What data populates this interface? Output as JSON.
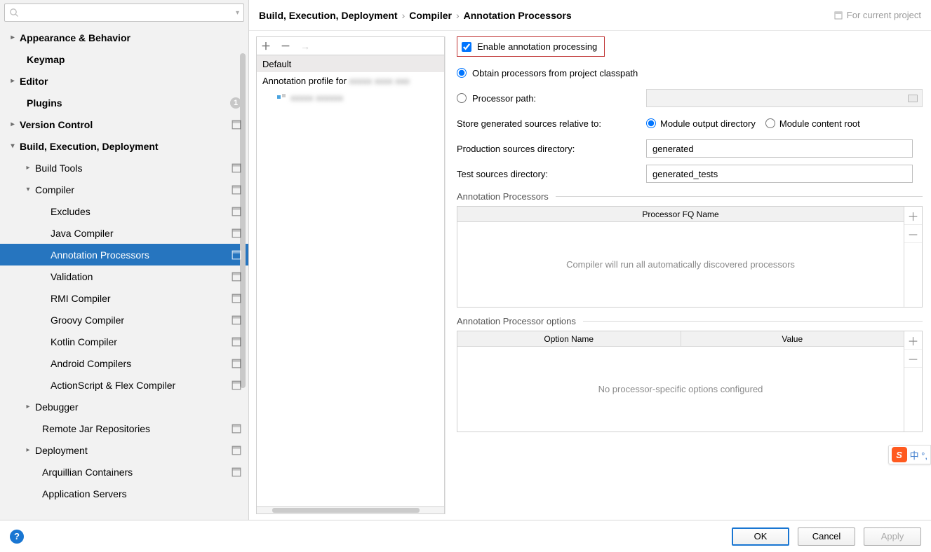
{
  "search": {
    "placeholder": ""
  },
  "sidebar": {
    "items": [
      {
        "label": "Appearance & Behavior",
        "bold": true,
        "chev": "right",
        "pad": "pad0"
      },
      {
        "label": "Keymap",
        "bold": true,
        "pad": "pad0c"
      },
      {
        "label": "Editor",
        "bold": true,
        "chev": "right",
        "pad": "pad0"
      },
      {
        "label": "Plugins",
        "bold": true,
        "pad": "pad0c",
        "badge": "1"
      },
      {
        "label": "Version Control",
        "bold": true,
        "chev": "right",
        "pad": "pad0",
        "proj": true
      },
      {
        "label": "Build, Execution, Deployment",
        "bold": true,
        "chev": "down",
        "pad": "pad0"
      },
      {
        "label": "Build Tools",
        "chev": "right",
        "pad": "pad1",
        "proj": true
      },
      {
        "label": "Compiler",
        "chev": "down",
        "pad": "pad1",
        "proj": true
      },
      {
        "label": "Excludes",
        "pad": "pad2",
        "proj": true
      },
      {
        "label": "Java Compiler",
        "pad": "pad2",
        "proj": true
      },
      {
        "label": "Annotation Processors",
        "pad": "pad2",
        "proj": true,
        "selected": true
      },
      {
        "label": "Validation",
        "pad": "pad2",
        "proj": true
      },
      {
        "label": "RMI Compiler",
        "pad": "pad2",
        "proj": true
      },
      {
        "label": "Groovy Compiler",
        "pad": "pad2",
        "proj": true
      },
      {
        "label": "Kotlin Compiler",
        "pad": "pad2",
        "proj": true
      },
      {
        "label": "Android Compilers",
        "pad": "pad2",
        "proj": true
      },
      {
        "label": "ActionScript & Flex Compiler",
        "pad": "pad2",
        "proj": true
      },
      {
        "label": "Debugger",
        "chev": "right",
        "pad": "pad1"
      },
      {
        "label": "Remote Jar Repositories",
        "pad": "pad1c",
        "proj": true
      },
      {
        "label": "Deployment",
        "chev": "right",
        "pad": "pad1",
        "proj": true
      },
      {
        "label": "Arquillian Containers",
        "pad": "pad1c",
        "proj": true
      },
      {
        "label": "Application Servers",
        "pad": "pad1c"
      }
    ]
  },
  "breadcrumb": {
    "a": "Build, Execution, Deployment",
    "b": "Compiler",
    "c": "Annotation Processors"
  },
  "forProject": "For current project",
  "profileList": {
    "default": "Default",
    "profile": "Annotation profile for",
    "profileBlur": "xxxxx xxxx xxo",
    "childBlur": "xxxxx xxxxxx"
  },
  "settings": {
    "enable": "Enable annotation processing",
    "obtain": "Obtain processors from project classpath",
    "procPath": "Processor path:",
    "storeLabel": "Store generated sources relative to:",
    "storeOpt1": "Module output directory",
    "storeOpt2": "Module content root",
    "prodLabel": "Production sources directory:",
    "prodVal": "generated",
    "testLabel": "Test sources directory:",
    "testVal": "generated_tests",
    "tbl1Title": "Annotation Processors",
    "tbl1Col": "Processor FQ Name",
    "tbl1Empty": "Compiler will run all automatically discovered processors",
    "tbl2Title": "Annotation Processor options",
    "tbl2Col1": "Option Name",
    "tbl2Col2": "Value",
    "tbl2Empty": "No processor-specific options configured"
  },
  "footer": {
    "ok": "OK",
    "cancel": "Cancel",
    "apply": "Apply"
  },
  "ime": {
    "s": "S",
    "t": "中 °,"
  }
}
